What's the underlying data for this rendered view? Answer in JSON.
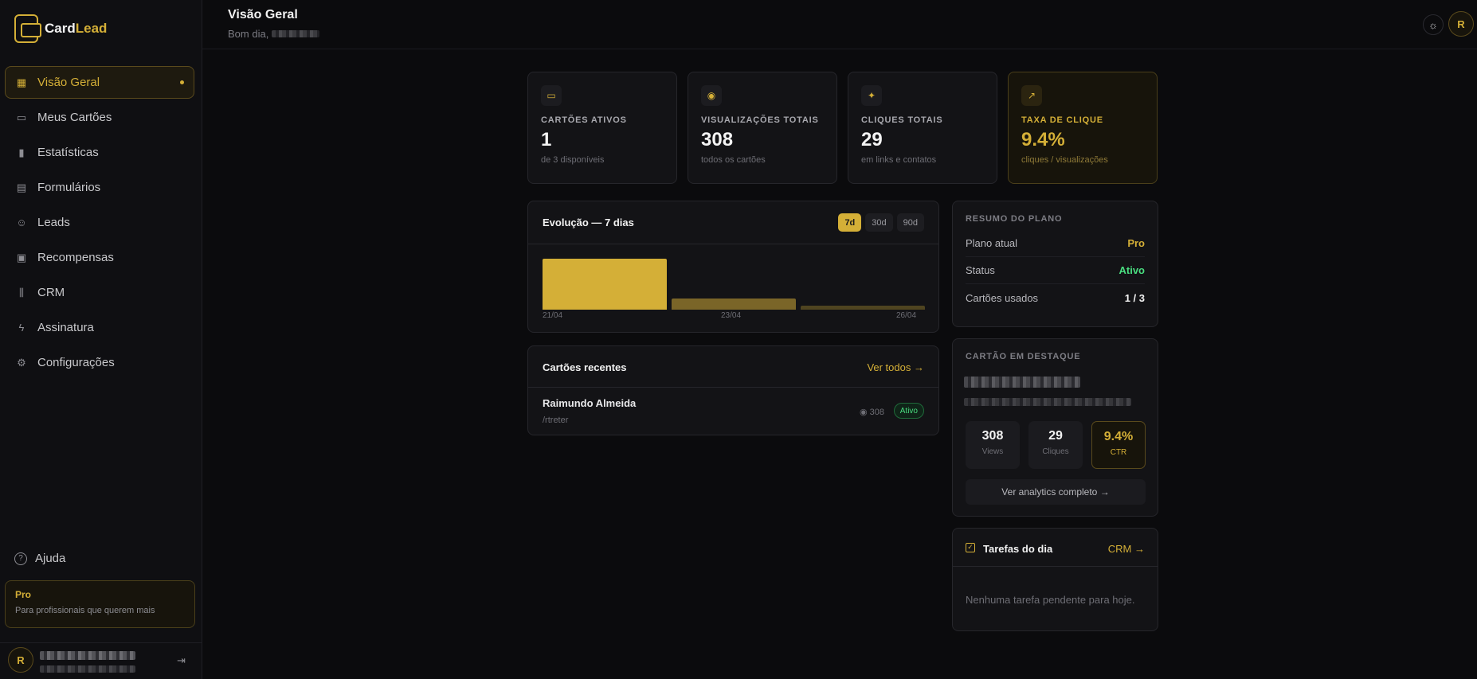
{
  "brand": {
    "name_main": "Card",
    "name_accent": "Lead"
  },
  "sidebar": {
    "items": [
      {
        "label": "Visão Geral",
        "icon": "grid-icon"
      },
      {
        "label": "Meus Cartões",
        "icon": "card-icon"
      },
      {
        "label": "Estatísticas",
        "icon": "bar-chart-icon"
      },
      {
        "label": "Formulários",
        "icon": "document-icon"
      },
      {
        "label": "Leads",
        "icon": "users-icon"
      },
      {
        "label": "Recompensas",
        "icon": "gift-icon"
      },
      {
        "label": "CRM",
        "icon": "kanban-icon"
      },
      {
        "label": "Assinatura",
        "icon": "bolt-icon"
      },
      {
        "label": "Configurações",
        "icon": "gear-icon"
      }
    ],
    "help_label": "Ajuda",
    "plan_title": "Pro",
    "plan_subtitle": "Para profissionais que querem mais",
    "user_initial": "R"
  },
  "header": {
    "title": "Visão Geral",
    "greeting": "Bom dia,",
    "user_initial": "R"
  },
  "stats": [
    {
      "label": "CARTÕES ATIVOS",
      "value": "1",
      "sub": "de 3 disponíveis",
      "icon": "card-icon"
    },
    {
      "label": "VISUALIZAÇÕES TOTAIS",
      "value": "308",
      "sub": "todos os cartões",
      "icon": "eye-icon"
    },
    {
      "label": "CLIQUES TOTAIS",
      "value": "29",
      "sub": "em links e contatos",
      "icon": "click-icon"
    },
    {
      "label": "TAXA DE CLIQUE",
      "value": "9.4%",
      "sub": "cliques / visualizações",
      "icon": "trending-up-icon"
    }
  ],
  "evolution": {
    "title": "Evolução — 7 dias",
    "ranges": [
      "7d",
      "30d",
      "90d"
    ],
    "active_range": "7d"
  },
  "chart_data": {
    "type": "bar",
    "title": "Evolução — 7 dias",
    "categories": [
      "21/04",
      "23/04",
      "26/04"
    ],
    "values": [
      100,
      22,
      8
    ],
    "tick_labels": [
      "21/04",
      "23/04",
      "26/04"
    ],
    "colors": [
      "#d4af37",
      "#7a6528",
      "#4f4420"
    ],
    "grid": false
  },
  "recent": {
    "title": "Cartões recentes",
    "see_all": "Ver todos",
    "rows": [
      {
        "name": "Raimundo Almeida",
        "slug": "/rtreter",
        "views": "308",
        "status": "Ativo"
      }
    ]
  },
  "plan": {
    "label": "RESUMO DO PLANO",
    "rows": [
      {
        "key": "Plano atual",
        "value": "Pro",
        "color": "#d4af37"
      },
      {
        "key": "Status",
        "value": "Ativo",
        "color": "#4ade80"
      },
      {
        "key": "Cartões usados",
        "value": "1 / 3",
        "color": "#f2f2f2"
      }
    ]
  },
  "featured": {
    "label": "CARTÃO EM DESTAQUE",
    "metrics": [
      {
        "value": "308",
        "label": "Views"
      },
      {
        "value": "29",
        "label": "Cliques"
      },
      {
        "value": "9.4%",
        "label": "CTR"
      }
    ],
    "button": "Ver analytics completo"
  },
  "tasks": {
    "title": "Tarefas do dia",
    "crm_link": "CRM",
    "empty": "Nenhuma tarefa pendente para hoje."
  },
  "colors": {
    "accent": "#d4af37",
    "background": "#0b0b0d",
    "success": "#4ade80"
  }
}
